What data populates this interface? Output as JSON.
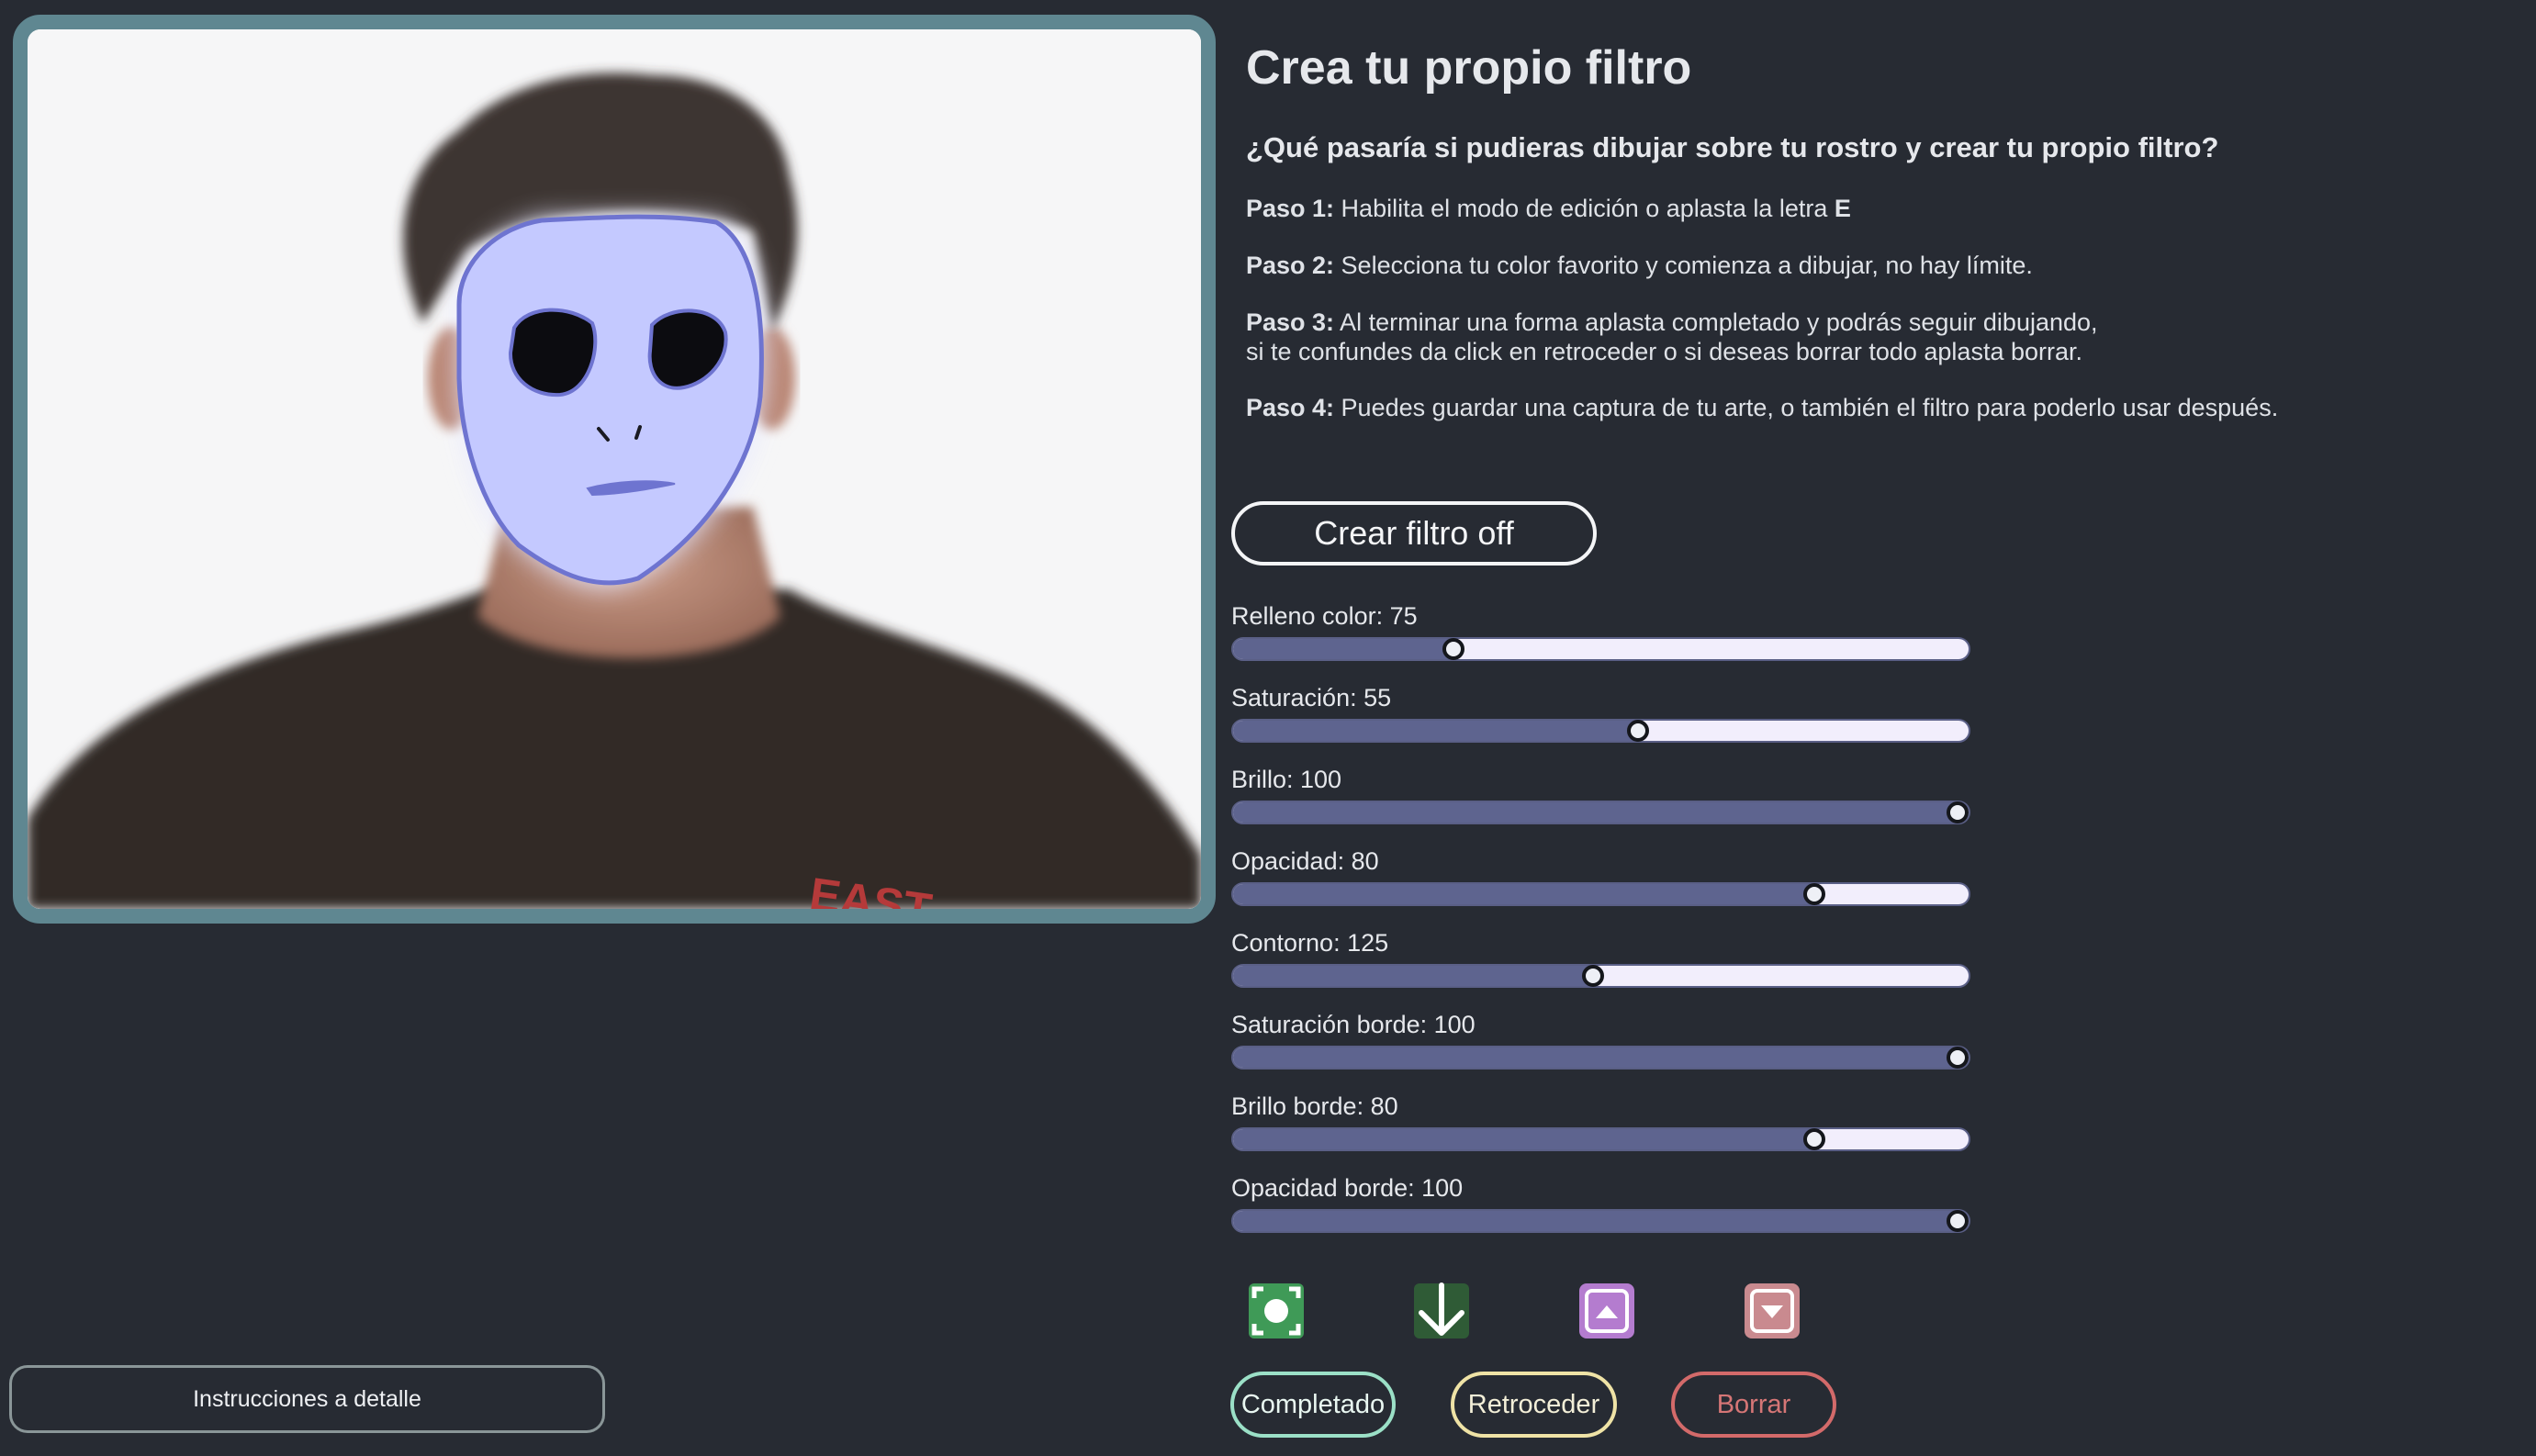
{
  "header": {
    "title": "Crea tu propio filtro",
    "subtitle": "¿Qué pasaría si pudieras dibujar sobre tu rostro y crear tu propio filtro?"
  },
  "steps": [
    {
      "label": "Paso 1:",
      "text": " Habilita el modo de edición o aplasta la letra ",
      "key": "E"
    },
    {
      "label": "Paso 2:",
      "text": " Selecciona tu color favorito y comienza a dibujar, no hay límite."
    },
    {
      "label": "Paso 3:",
      "text": " Al terminar una forma aplasta completado y podrás seguir dibujando,",
      "line2": "si te confundes da click en retroceder o si deseas borrar todo aplasta borrar."
    },
    {
      "label": "Paso 4:",
      "text": " Puedes guardar una captura de tu arte, o también el filtro para poderlo usar después."
    }
  ],
  "toggle": {
    "label": "Crear filtro off"
  },
  "sliders": [
    {
      "label": "Relleno color: 75",
      "fraction": 0.3
    },
    {
      "label": "Saturación: 55",
      "fraction": 0.55
    },
    {
      "label": "Brillo: 100",
      "fraction": 0.985
    },
    {
      "label": "Opacidad: 80",
      "fraction": 0.79
    },
    {
      "label": "Contorno: 125",
      "fraction": 0.49
    },
    {
      "label": "Saturación borde: 100",
      "fraction": 0.985
    },
    {
      "label": "Brillo borde: 80",
      "fraction": 0.79
    },
    {
      "label": "Opacidad borde: 100",
      "fraction": 0.985
    }
  ],
  "tools": [
    {
      "name": "capture-icon",
      "color": "#3f9a57"
    },
    {
      "name": "download-icon",
      "color": "#2f5b36"
    },
    {
      "name": "upload-filter-icon",
      "color": "#b47ccf"
    },
    {
      "name": "load-filter-icon",
      "color": "#c98a8f"
    }
  ],
  "actions": {
    "completed": "Completado",
    "undo": "Retroceder",
    "clear": "Borrar"
  },
  "footer": {
    "instructions": "Instrucciones a detalle"
  },
  "camera": {
    "shirt_text": "EAST",
    "mask_fill": "#c4c9ff",
    "mask_stroke": "#6e74d0"
  }
}
